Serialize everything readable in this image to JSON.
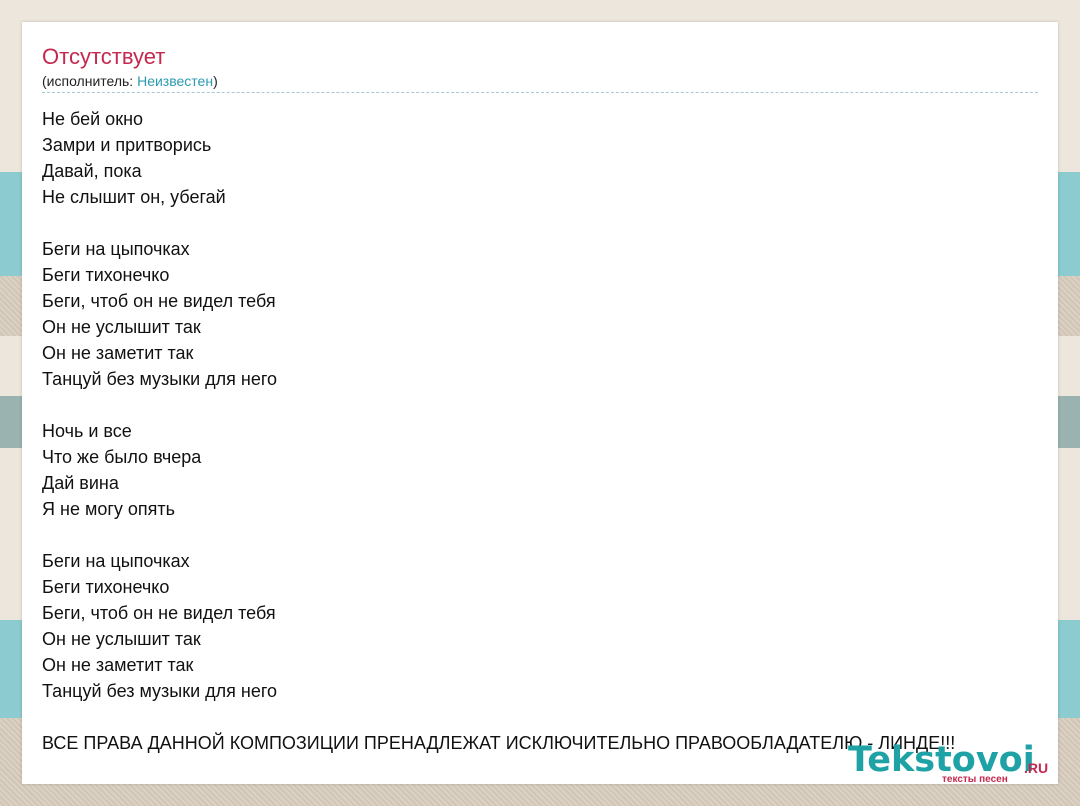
{
  "song": {
    "title": "Отсутствует",
    "artist_prefix": "(исполнитель: ",
    "artist_name": "Неизвестен",
    "artist_suffix": ")"
  },
  "lyrics": [
    "Не бей окно",
    "Замри и притворись",
    "Давай, пока",
    "Не слышит он, убегай",
    "",
    "Беги на цыпочках",
    "Беги тихонечко",
    "Беги, чтоб он не видел тебя",
    "Он не услышит так",
    "Он не заметит так",
    "Танцуй без музыки для него",
    "",
    "Ночь и все",
    "Что же было вчера",
    "Дай вина",
    "Я не могу опять",
    "",
    "Беги на цыпочках",
    "Беги тихонечко",
    "Беги, чтоб он не видел тебя",
    "Он не услышит так",
    "Он не заметит так",
    "Танцуй без музыки для него",
    "",
    "ВСЕ ПРАВА ДАННОЙ КОМПОЗИЦИИ ПРЕНАДЛЕЖАТ ИСКЛЮЧИТЕЛЬНО ПРАВООБЛАДАТЕЛЮ - ЛИНДЕ!!!"
  ],
  "logo": {
    "main": "Tekstovoi",
    "tld": ".RU",
    "tagline": "тексты песен"
  },
  "colors": {
    "title": "#c4294f",
    "link": "#2a9bb0",
    "logo": "#1ea2a6"
  }
}
